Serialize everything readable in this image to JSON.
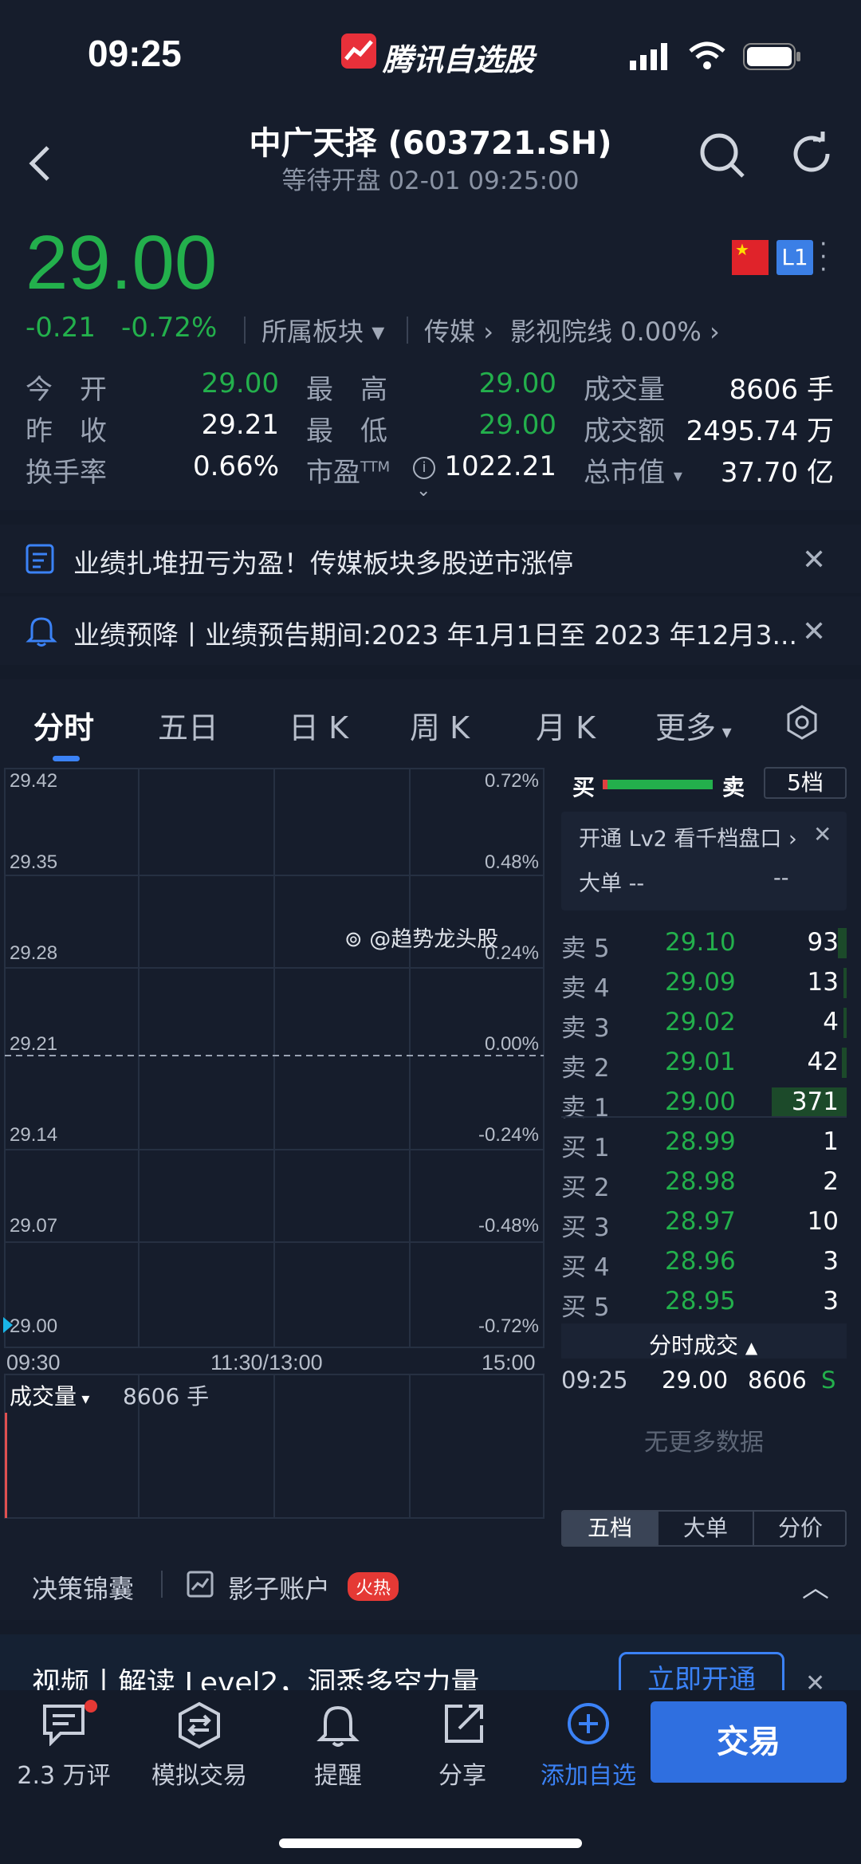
{
  "status": {
    "time": "09:25",
    "app_name": "腾讯自选股"
  },
  "header": {
    "title": "中广天择 (603721.SH)",
    "subtitle": "等待开盘   02-01 09:25:00"
  },
  "quote": {
    "price": "29.00",
    "change": "-0.21",
    "change_pct": "-0.72%",
    "sector_label": "所属板块",
    "sector1": "传媒",
    "sector2": "影视院线 0.00%",
    "badge": "L1",
    "rows": [
      {
        "l1": "今　开",
        "v1": "29.00",
        "l2": "最　高",
        "v2": "29.00",
        "l3": "成交量",
        "v3": "8606 手"
      },
      {
        "l1": "昨　收",
        "v1": "29.21",
        "l2": "最　低",
        "v2": "29.00",
        "l3": "成交额",
        "v3": "2495.74 万"
      },
      {
        "l1": "换手率",
        "v1": "0.66%",
        "l2": "市盈",
        "l2sup": "TTM",
        "v2": "1022.21",
        "l3": "总市值",
        "v3": "37.70 亿"
      }
    ]
  },
  "banners": [
    {
      "text": "业绩扎堆扭亏为盈！传媒板块多股逆市涨停"
    },
    {
      "text": "业绩预降丨业绩预告期间:2023 年1月1日至 2023 年12月3..."
    }
  ],
  "tabs": [
    "分时",
    "五日",
    "日 K",
    "周 K",
    "月 K",
    "更多"
  ],
  "chart": {
    "left_ticks": [
      "29.42",
      "29.35",
      "29.28",
      "29.21",
      "29.14",
      "29.07",
      "29.00"
    ],
    "right_ticks": [
      "0.72%",
      "0.48%",
      "0.24%",
      "0.00%",
      "-0.24%",
      "-0.48%",
      "-0.72%"
    ],
    "x_ticks": [
      "09:30",
      "11:30/13:00",
      "15:00"
    ],
    "watermark": "@趋势龙头股",
    "volume_label": "成交量",
    "volume_value": "8606 手"
  },
  "orderbook": {
    "buy_label": "买",
    "sell_label": "卖",
    "depth": "5档",
    "promo": "开通 Lv2 看千档盘口",
    "bigorder": "大单 --",
    "bigorder_val": "--",
    "asks": [
      {
        "label": "卖 5",
        "price": "29.10",
        "qty": "93",
        "ratio": 0.07
      },
      {
        "label": "卖 4",
        "price": "29.09",
        "qty": "13",
        "ratio": 0.02
      },
      {
        "label": "卖 3",
        "price": "29.02",
        "qty": "4",
        "ratio": 0.01
      },
      {
        "label": "卖 2",
        "price": "29.01",
        "qty": "42",
        "ratio": 0.04
      },
      {
        "label": "卖 1",
        "price": "29.00",
        "qty": "371",
        "ratio": 0.6
      }
    ],
    "bids": [
      {
        "label": "买 1",
        "price": "28.99",
        "qty": "1"
      },
      {
        "label": "买 2",
        "price": "28.98",
        "qty": "2"
      },
      {
        "label": "买 3",
        "price": "28.97",
        "qty": "10"
      },
      {
        "label": "买 4",
        "price": "28.96",
        "qty": "3"
      },
      {
        "label": "买 5",
        "price": "28.95",
        "qty": "3"
      }
    ],
    "trades_title": "分时成交",
    "trade": {
      "time": "09:25",
      "price": "29.00",
      "qty": "8606",
      "side": "S"
    },
    "no_more": "无更多数据",
    "tabs": [
      "五档",
      "大单",
      "分价"
    ]
  },
  "strip": {
    "item1": "决策锦囊",
    "item2": "影子账户",
    "hot": "火热"
  },
  "promo_banner": {
    "text": "视频丨解读 Level2，洞悉多空力量",
    "button": "立即开通"
  },
  "nav": {
    "comments": "2.3 万评",
    "simulate": "模拟交易",
    "alert": "提醒",
    "share": "分享",
    "add": "添加自选",
    "trade": "交易"
  }
}
